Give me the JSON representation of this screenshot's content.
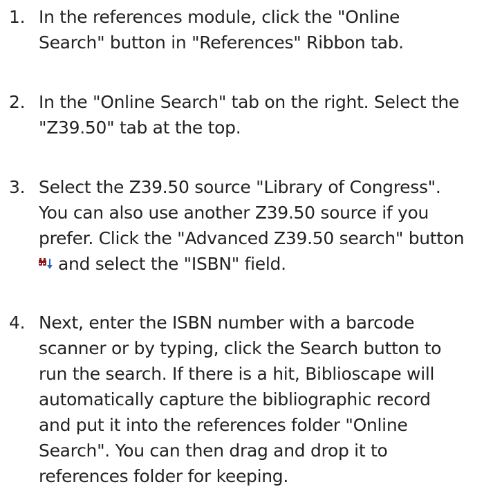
{
  "steps": [
    {
      "number": "1.",
      "lines": [
        "In the references module, click the \"Online",
        "Search\" button in \"References\" Ribbon tab."
      ]
    },
    {
      "number": "2.",
      "lines": [
        "In the \"Online Search\" tab on the right. Select the",
        "\"Z39.50\" tab at the top."
      ]
    },
    {
      "number": "3.",
      "lines": [
        "Select the Z39.50 source \"Library of Congress\".",
        "You can also use another Z39.50 source if you",
        "prefer. Click the \"Advanced Z39.50 search\" button",
        "and select  the \"ISBN\" field."
      ],
      "icon": "binoculars-dropdown-icon"
    },
    {
      "number": "4.",
      "lines": [
        "Next, enter the ISBN number with a barcode",
        "scanner or by typing, click the Search button to",
        "run the search. If there is a hit, Biblioscape will",
        "automatically capture the bibliographic record",
        "and put it into the references folder \"Online",
        "Search\". You can then drag and drop it to",
        "references folder for keeping."
      ]
    }
  ],
  "colors": {
    "text": "#222222",
    "icon_binoculars": "#8a1a1a",
    "icon_arrow": "#2a62c9"
  }
}
